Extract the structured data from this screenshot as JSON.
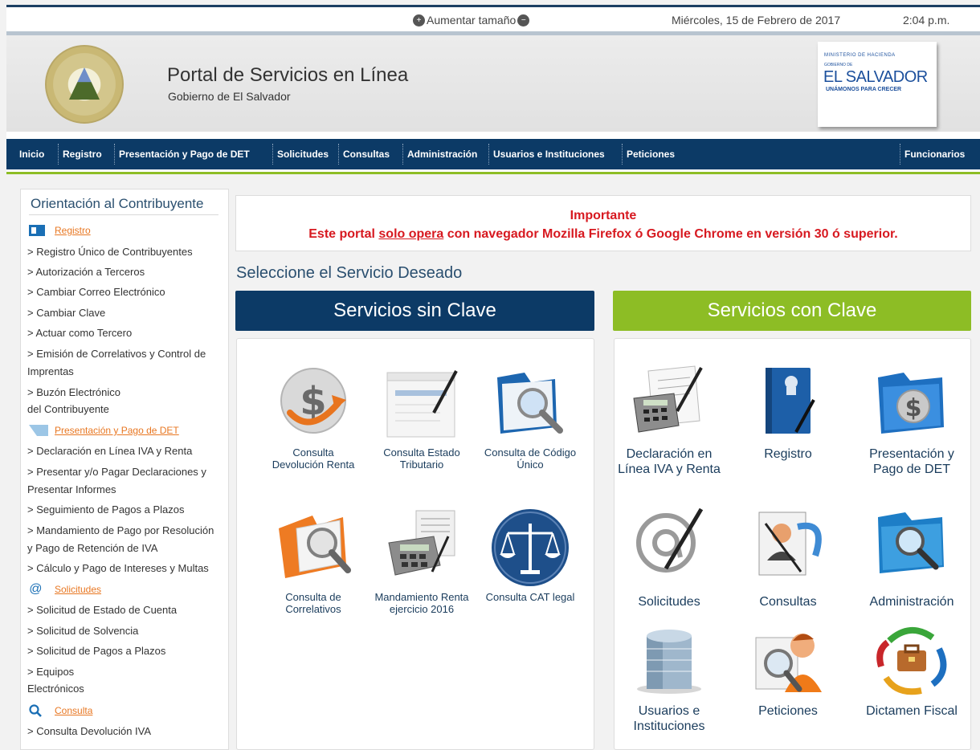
{
  "topbar": {
    "zoom_label": "Aumentar tamaño",
    "date": "Miércoles, 15 de Febrero de 2017",
    "time": "2:04 p.m."
  },
  "header": {
    "title": "Portal de Servicios en Línea",
    "subtitle": "Gobierno de El Salvador",
    "logo_line1": "MINISTERIO DE HACIENDA",
    "logo_line2": "GOBIERNO DE",
    "logo_line3": "EL SALVADOR",
    "logo_line4": "UNÁMONOS PARA CRECER"
  },
  "nav": {
    "items": [
      "Inicio",
      "Registro",
      "Presentación y Pago de DET",
      "Solicitudes",
      "Consultas",
      "Administración",
      "Usuarios e Instituciones",
      "Peticiones"
    ],
    "right": "Funcionarios"
  },
  "sidebar": {
    "title": "Orientación al Contribuyente",
    "sections": {
      "registro": "Registro",
      "presentacion": "Presentación y Pago de DET",
      "solicitudes": "Solicitudes",
      "consulta": "Consulta"
    },
    "links": [
      "> Registro Único de Contribuyentes",
      "> Autorización a Terceros",
      "> Cambiar Correo Electrónico",
      "> Cambiar Clave",
      "> Actuar como Tercero",
      "> Emisión de Correlativos y Control de",
      "Imprentas",
      "> Buzón Electrónico",
      "del Contribuyente",
      "> Declaración en Línea IVA y Renta",
      "> Presentar y/o Pagar Declaraciones y",
      "Presentar Informes",
      "> Seguimiento de Pagos a Plazos",
      "> Mandamiento de Pago por Resolución",
      "y Pago de Retención de IVA",
      "> Cálculo y Pago de Intereses y Multas",
      "> Solicitud de Estado de Cuenta",
      "> Solicitud de Solvencia",
      "> Solicitud de Pagos a Plazos",
      "> Equipos",
      "Electrónicos",
      "> Consulta Devolución IVA"
    ]
  },
  "alert": {
    "heading": "Importante",
    "text_before": "Este portal ",
    "text_underline": "solo opera",
    "text_after": " con navegador Mozilla Firefox ó Google Chrome en versión 30 ó superior."
  },
  "main": {
    "select_title": "Seleccione el Servicio Deseado",
    "sin_clave": "Servicios sin Clave",
    "con_clave": "Servicios con Clave",
    "sin_tiles": [
      [
        "Consulta",
        "Devolución Renta"
      ],
      [
        "Consulta Estado",
        "Tributario"
      ],
      [
        "Consulta de Código",
        "Único"
      ],
      [
        "Consulta de",
        "Correlativos"
      ],
      [
        "Mandamiento Renta",
        "ejercicio 2016"
      ],
      [
        "Consulta CAT legal"
      ]
    ],
    "con_tiles": [
      [
        "Declaración en",
        "Línea IVA y Renta"
      ],
      [
        "Registro"
      ],
      [
        "Presentación y",
        "Pago de DET"
      ],
      [
        "Solicitudes"
      ],
      [
        "Consultas"
      ],
      [
        "Administración"
      ],
      [
        "Usuarios e",
        "Instituciones"
      ],
      [
        "Peticiones"
      ],
      [
        "Dictamen Fiscal"
      ]
    ]
  },
  "colors": {
    "navy": "#0c3a66",
    "green": "#8dbd25",
    "alert_red": "#d71920",
    "link_orange": "#e87722"
  }
}
